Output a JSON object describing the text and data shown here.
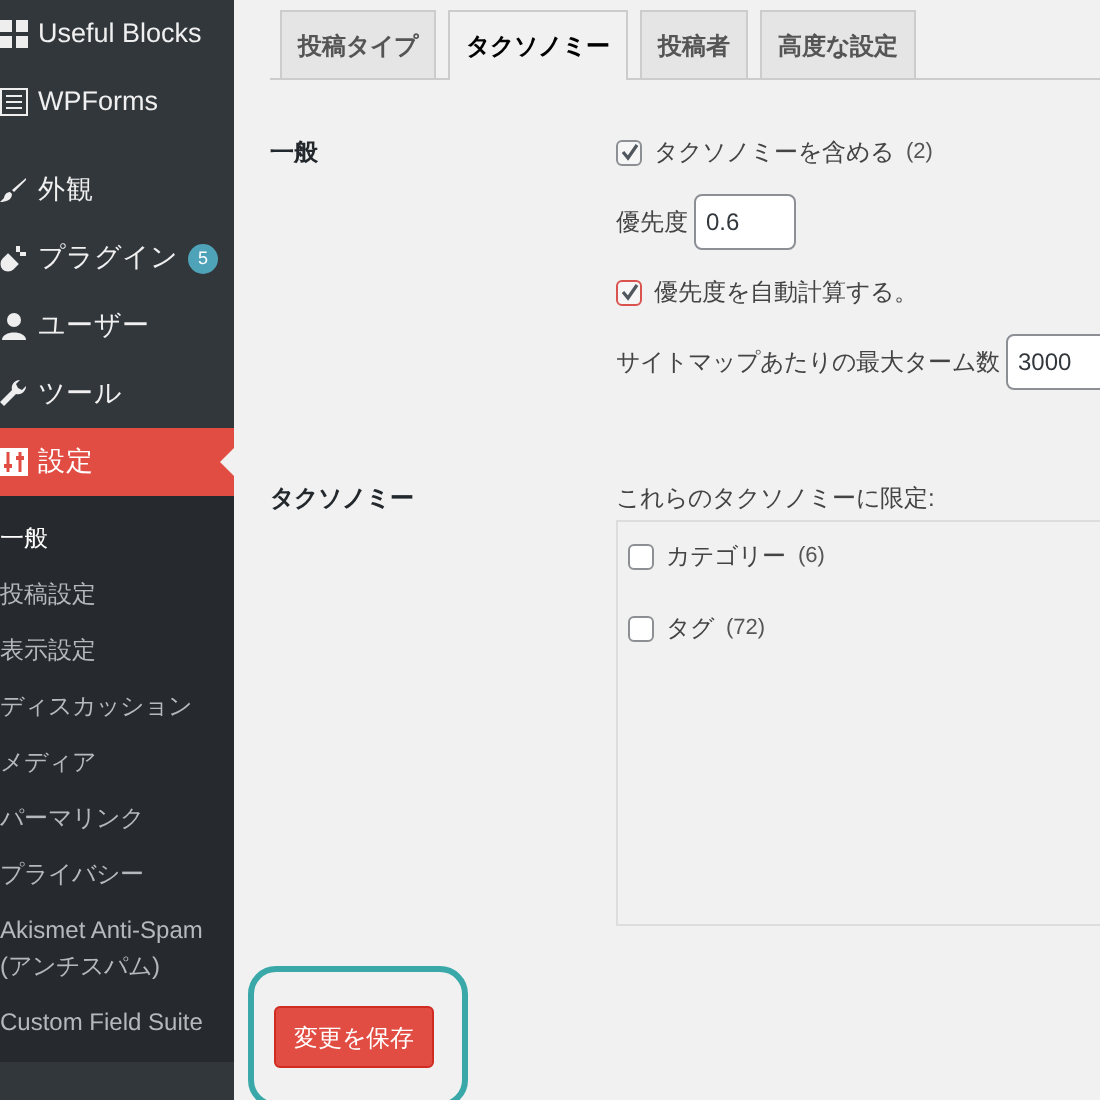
{
  "sidebar": {
    "menu_groups": [
      {
        "items": [
          {
            "label": "Useful Blocks",
            "selected": false
          },
          {
            "label": "WPForms",
            "selected": false
          }
        ]
      },
      {
        "items": [
          {
            "label": "外観",
            "selected": false
          },
          {
            "label": "プラグイン",
            "selected": false,
            "badge": "5"
          },
          {
            "label": "ユーザー",
            "selected": false
          },
          {
            "label": "ツール",
            "selected": false
          },
          {
            "label": "設定",
            "selected": true
          }
        ]
      }
    ],
    "submenu": [
      {
        "label": "一般",
        "selected": true
      },
      {
        "label": "投稿設定",
        "selected": false
      },
      {
        "label": "表示設定",
        "selected": false
      },
      {
        "label": "ディスカッション",
        "selected": false
      },
      {
        "label": "メディア",
        "selected": false
      },
      {
        "label": "パーマリンク",
        "selected": false
      },
      {
        "label": "プライバシー",
        "selected": false
      },
      {
        "label": "Akismet Anti-Spam (アンチスパム)",
        "selected": false
      },
      {
        "label": "Custom Field Suite",
        "selected": false
      }
    ]
  },
  "tabs": [
    {
      "label": "投稿タイプ",
      "selected": false
    },
    {
      "label": "タクソノミー",
      "selected": true
    },
    {
      "label": "投稿者",
      "selected": false
    },
    {
      "label": "高度な設定",
      "selected": false
    }
  ],
  "general": {
    "label": "一般",
    "include": {
      "label": "タクソノミーを含める",
      "count": "(2)",
      "checked": true
    },
    "priority": {
      "label": "優先度",
      "value": "0.6"
    },
    "auto_priority": {
      "label": "優先度を自動計算する。",
      "checked": true,
      "focused": true
    },
    "max_terms": {
      "label": "サイトマップあたりの最大ターム数",
      "value": "3000"
    }
  },
  "taxonomy": {
    "label": "タクソノミー",
    "limit_label": "これらのタクソノミーに限定:",
    "options": [
      {
        "label": "カテゴリー",
        "count": "(6)",
        "checked": false
      },
      {
        "label": "タグ",
        "count": "(72)",
        "checked": false
      }
    ]
  },
  "save_button": {
    "label": "変更を保存",
    "highlighted": true
  }
}
